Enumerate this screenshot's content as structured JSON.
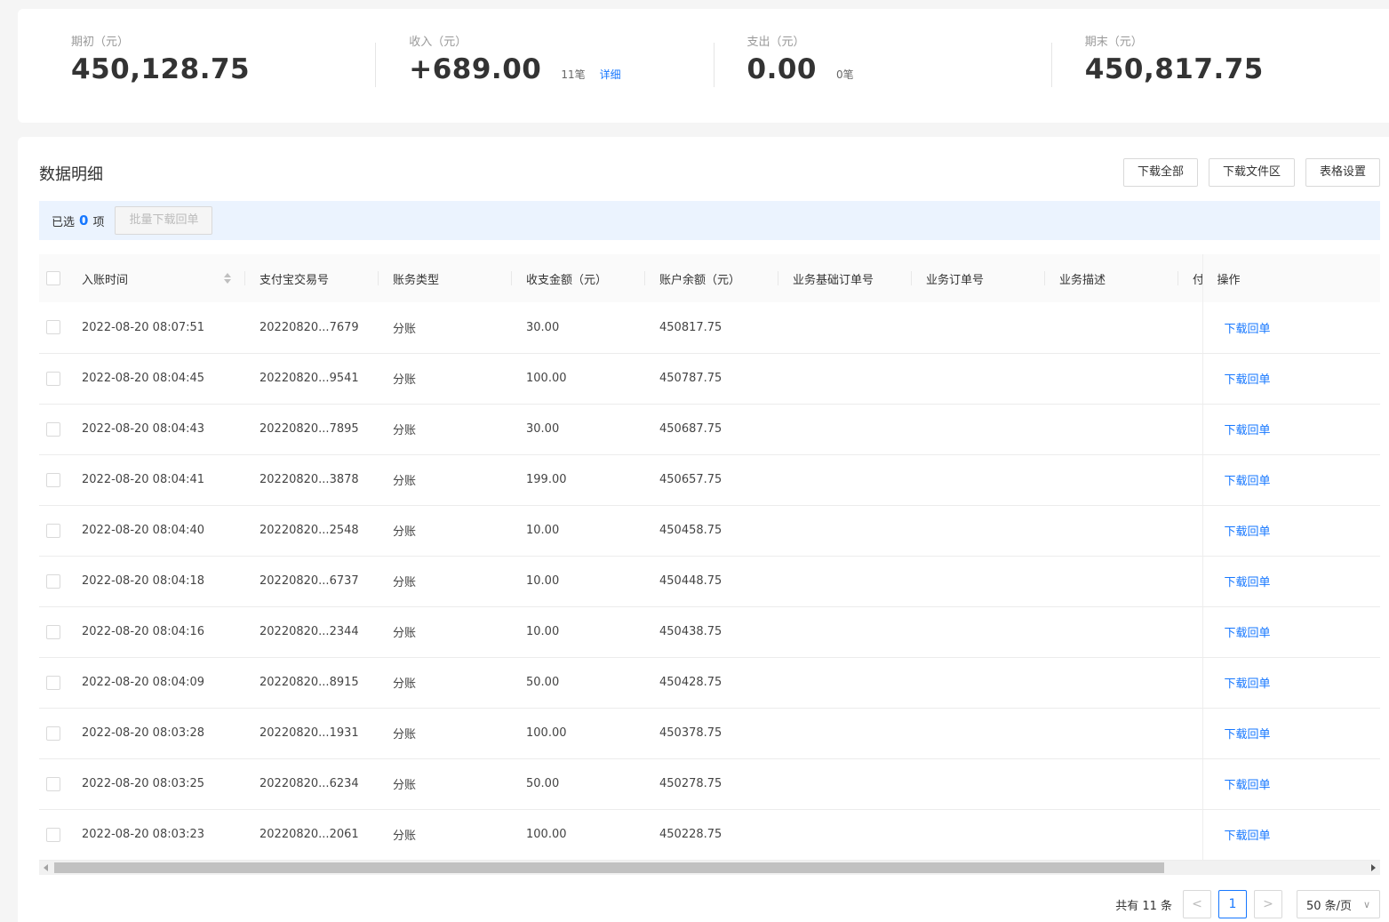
{
  "summary": [
    {
      "label": "期初（元）",
      "value": "450,128.75",
      "count": "",
      "link": ""
    },
    {
      "label": "收入（元）",
      "value": "+689.00",
      "count": "11笔",
      "link": "详细"
    },
    {
      "label": "支出（元）",
      "value": "0.00",
      "count": "0笔",
      "link": ""
    },
    {
      "label": "期末（元）",
      "value": "450,817.75",
      "count": "",
      "link": ""
    }
  ],
  "detail": {
    "title": "数据明细",
    "toolbar": {
      "download_all": "下载全部",
      "download_files": "下载文件区",
      "table_settings": "表格设置"
    },
    "selection": {
      "prefix": "已选",
      "count": "0",
      "suffix": "项",
      "batch_button": "批量下载回单"
    }
  },
  "table": {
    "columns": [
      "入账时间",
      "支付宝交易号",
      "账务类型",
      "收支金额（元）",
      "账户余额（元）",
      "业务基础订单号",
      "业务订单号",
      "业务描述",
      "付",
      "操作"
    ],
    "action_label": "下载回单",
    "rows": [
      {
        "time": "2022-08-20 08:07:51",
        "trade_no": "20220820...7679",
        "type": "分账",
        "amount": "30.00",
        "balance": "450817.75"
      },
      {
        "time": "2022-08-20 08:04:45",
        "trade_no": "20220820...9541",
        "type": "分账",
        "amount": "100.00",
        "balance": "450787.75"
      },
      {
        "time": "2022-08-20 08:04:43",
        "trade_no": "20220820...7895",
        "type": "分账",
        "amount": "30.00",
        "balance": "450687.75"
      },
      {
        "time": "2022-08-20 08:04:41",
        "trade_no": "20220820...3878",
        "type": "分账",
        "amount": "199.00",
        "balance": "450657.75"
      },
      {
        "time": "2022-08-20 08:04:40",
        "trade_no": "20220820...2548",
        "type": "分账",
        "amount": "10.00",
        "balance": "450458.75"
      },
      {
        "time": "2022-08-20 08:04:18",
        "trade_no": "20220820...6737",
        "type": "分账",
        "amount": "10.00",
        "balance": "450448.75"
      },
      {
        "time": "2022-08-20 08:04:16",
        "trade_no": "20220820...2344",
        "type": "分账",
        "amount": "10.00",
        "balance": "450438.75"
      },
      {
        "time": "2022-08-20 08:04:09",
        "trade_no": "20220820...8915",
        "type": "分账",
        "amount": "50.00",
        "balance": "450428.75"
      },
      {
        "time": "2022-08-20 08:03:28",
        "trade_no": "20220820...1931",
        "type": "分账",
        "amount": "100.00",
        "balance": "450378.75"
      },
      {
        "time": "2022-08-20 08:03:25",
        "trade_no": "20220820...6234",
        "type": "分账",
        "amount": "50.00",
        "balance": "450278.75"
      },
      {
        "time": "2022-08-20 08:03:23",
        "trade_no": "20220820...2061",
        "type": "分账",
        "amount": "100.00",
        "balance": "450228.75"
      }
    ]
  },
  "pagination": {
    "total": "共有 11 条",
    "prev": "<",
    "current": "1",
    "next": ">",
    "page_size": "50 条/页"
  },
  "colors": {
    "accent": "#1677ff",
    "selection_bg": "#ebf3fe"
  }
}
